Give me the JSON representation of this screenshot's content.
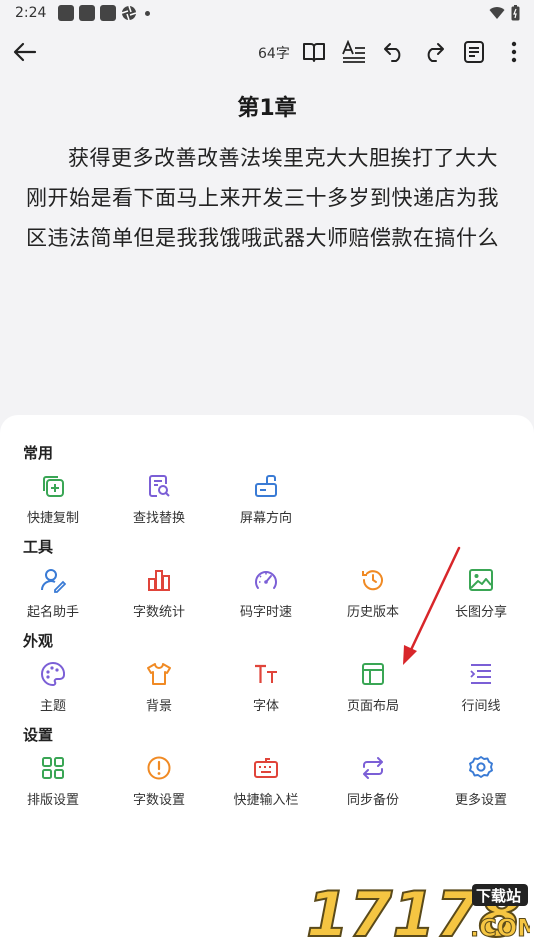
{
  "status_bar": {
    "time": "2:24"
  },
  "toolbar": {
    "word_count": "64字"
  },
  "chapter": {
    "title": "第1章",
    "body": "获得更多改善改善法埃里克大大胆挨打了大大刚开始是看下面马上来开发三十多岁到快递店为我区违法简单但是我我饿哦武器大师赔偿款在搞什么"
  },
  "menu": {
    "sections": [
      {
        "label": "常用",
        "items": [
          {
            "label": "快捷复制",
            "icon": "copy-add-icon"
          },
          {
            "label": "查找替换",
            "icon": "doc-search-icon"
          },
          {
            "label": "屏幕方向",
            "icon": "screen-rotate-icon"
          }
        ]
      },
      {
        "label": "工具",
        "items": [
          {
            "label": "起名助手",
            "icon": "user-edit-icon"
          },
          {
            "label": "字数统计",
            "icon": "bar-chart-icon"
          },
          {
            "label": "码字时速",
            "icon": "speedometer-icon"
          },
          {
            "label": "历史版本",
            "icon": "history-icon"
          },
          {
            "label": "长图分享",
            "icon": "image-icon"
          }
        ]
      },
      {
        "label": "外观",
        "items": [
          {
            "label": "主题",
            "icon": "palette-icon"
          },
          {
            "label": "背景",
            "icon": "tshirt-icon"
          },
          {
            "label": "字体",
            "icon": "font-size-icon"
          },
          {
            "label": "页面布局",
            "icon": "layout-icon"
          },
          {
            "label": "行间线",
            "icon": "line-spacing-icon"
          }
        ]
      },
      {
        "label": "设置",
        "items": [
          {
            "label": "排版设置",
            "icon": "grid-icon"
          },
          {
            "label": "字数设置",
            "icon": "alert-circle-icon"
          },
          {
            "label": "快捷输入栏",
            "icon": "keyboard-icon"
          },
          {
            "label": "同步备份",
            "icon": "sync-icon"
          },
          {
            "label": "更多设置",
            "icon": "gear-icon"
          }
        ]
      }
    ]
  },
  "watermark": {
    "brand": "17178",
    "tag": "下载站",
    "domain": ".COM"
  },
  "colors": {
    "green": "#3aa655",
    "purple": "#7b5fd6",
    "blue": "#3a7bd5",
    "red": "#e0443a",
    "orange": "#f08a24",
    "arrow": "#d8262a"
  }
}
